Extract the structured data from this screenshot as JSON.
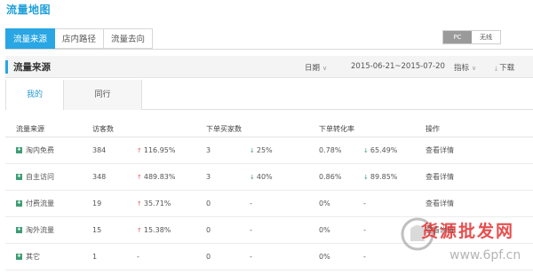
{
  "app_title": "流量地图",
  "top_tabs": [
    {
      "label": "流量来源",
      "active": true
    },
    {
      "label": "店内路径",
      "active": false
    },
    {
      "label": "流量去向",
      "active": false
    }
  ],
  "device_toggle": {
    "pc_label": "PC",
    "wireless_label": "无线",
    "active": "PC"
  },
  "section": {
    "title": "流量来源",
    "date_label": "日期",
    "date_range": "2015-06-21~2015-07-20",
    "metric_label": "指标",
    "download_label": "下载"
  },
  "sub_tabs": [
    {
      "label": "我的",
      "active": true
    },
    {
      "label": "同行",
      "active": false
    }
  ],
  "table": {
    "headers": [
      "流量来源",
      "访客数",
      "",
      "下单买家数",
      "",
      "下单转化率",
      "",
      "操作"
    ],
    "rows": [
      {
        "source": "淘内免费",
        "visitors": "384",
        "visitors_trend": "116.95%",
        "visitors_dir": "up",
        "buyers": "3",
        "buyers_trend": "25%",
        "buyers_dir": "down",
        "conv": "0.78%",
        "conv_trend": "65.49%",
        "conv_dir": "down",
        "action": "查看详情"
      },
      {
        "source": "自主访问",
        "visitors": "348",
        "visitors_trend": "489.83%",
        "visitors_dir": "up",
        "buyers": "3",
        "buyers_trend": "40%",
        "buyers_dir": "down",
        "conv": "0.86%",
        "conv_trend": "89.85%",
        "conv_dir": "down",
        "action": "查看详情"
      },
      {
        "source": "付费流量",
        "visitors": "19",
        "visitors_trend": "35.71%",
        "visitors_dir": "up",
        "buyers": "0",
        "buyers_trend": "-",
        "buyers_dir": "none",
        "conv": "0%",
        "conv_trend": "-",
        "conv_dir": "none",
        "action": "查看详情"
      },
      {
        "source": "淘外流量",
        "visitors": "15",
        "visitors_trend": "15.38%",
        "visitors_dir": "up",
        "buyers": "0",
        "buyers_trend": "-",
        "buyers_dir": "none",
        "conv": "0%",
        "conv_trend": "-",
        "conv_dir": "none",
        "action": "查看详情"
      },
      {
        "source": "其它",
        "visitors": "1",
        "visitors_trend": "-",
        "visitors_dir": "none",
        "buyers": "0",
        "buyers_trend": "-",
        "buyers_dir": "none",
        "conv": "0%",
        "conv_trend": "-",
        "conv_dir": "none",
        "action": ""
      }
    ]
  },
  "watermark": {
    "text": "货源批发网",
    "url": "www.6pf.cn"
  }
}
